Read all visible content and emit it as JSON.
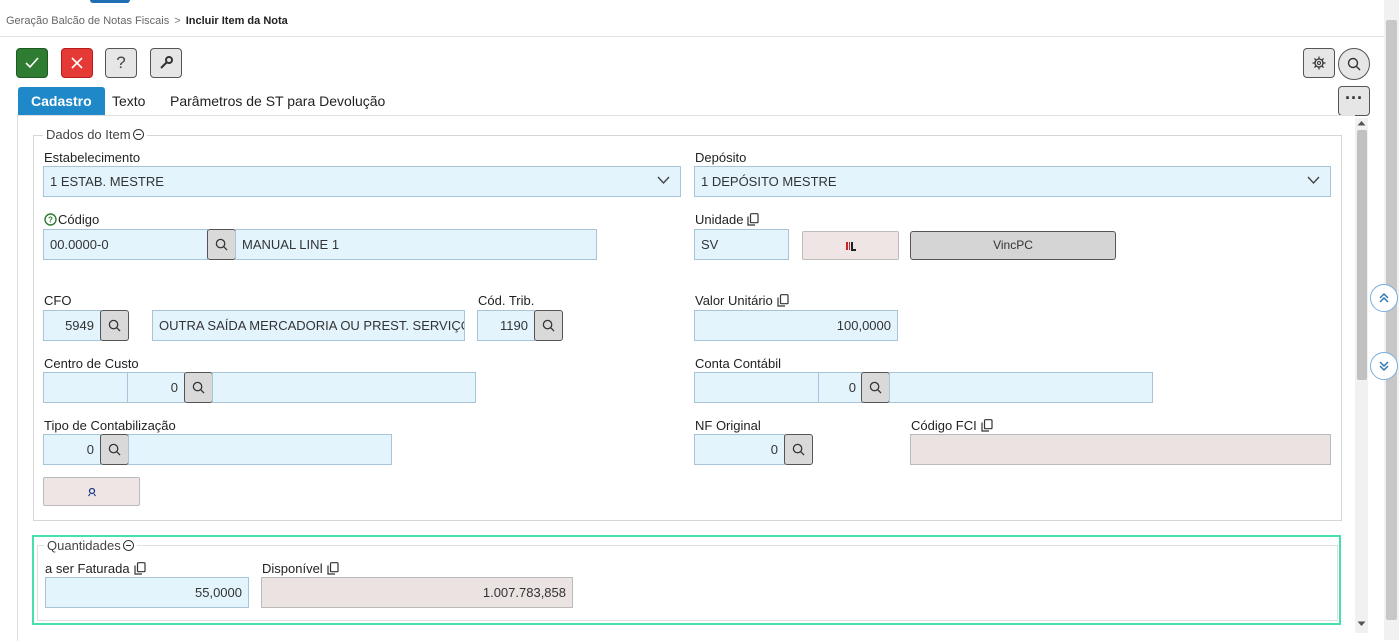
{
  "breadcrumb": {
    "parent": "Geração Balcão de Notas Fiscais",
    "separator": ">",
    "current": "Incluir Item da Nota"
  },
  "toolbar": {
    "confirm_icon": "check-icon",
    "cancel_icon": "close-icon",
    "help_label": "?",
    "tools_icon": "wrench-icon"
  },
  "tabs": [
    {
      "label": "Cadastro",
      "active": true
    },
    {
      "label": "Texto",
      "active": false
    },
    {
      "label": "Parâmetros de ST para Devolução",
      "active": false
    }
  ],
  "more_button": "···",
  "dados_item": {
    "legend": "Dados do Item",
    "estabelecimento": {
      "label": "Estabelecimento",
      "value": "1 ESTAB. MESTRE"
    },
    "deposito": {
      "label": "Depósito",
      "value": "1 DEPÓSITO MESTRE"
    },
    "codigo": {
      "label": "Código",
      "value": "00.0000-0",
      "description": "MANUAL LINE 1"
    },
    "unidade": {
      "label": "Unidade",
      "value": "SV",
      "vinc_label": "VincPC"
    },
    "cfo": {
      "label": "CFO",
      "value": "5949",
      "description": "OUTRA SAÍDA MERCADORIA OU PREST. SERVIÇO"
    },
    "cod_trib": {
      "label": "Cód. Trib.",
      "value": "1190"
    },
    "valor_unitario": {
      "label": "Valor Unitário",
      "value": "100,0000"
    },
    "centro_custo": {
      "label": "Centro de Custo",
      "value1": "",
      "value2": "0",
      "description": ""
    },
    "conta_contabil": {
      "label": "Conta Contábil",
      "value1": "",
      "value2": "0",
      "description": ""
    },
    "tipo_contabilizacao": {
      "label": "Tipo de Contabilização",
      "value": "0",
      "description": ""
    },
    "nf_original": {
      "label": "NF Original",
      "value": "0"
    },
    "codigo_fci": {
      "label": "Código FCI",
      "value": ""
    }
  },
  "quantidades": {
    "legend": "Quantidades",
    "a_ser_faturada": {
      "label": "a ser Faturada",
      "value": "55,0000"
    },
    "disponivel": {
      "label": "Disponível",
      "value": "1.007.783,858"
    }
  },
  "colors": {
    "accent": "#1e88c8",
    "confirm": "#2e7d32",
    "cancel": "#e53935",
    "input_bg": "#e3f4fd",
    "readonly_bg": "#ebe2e2",
    "highlight": "#46e0a8"
  }
}
